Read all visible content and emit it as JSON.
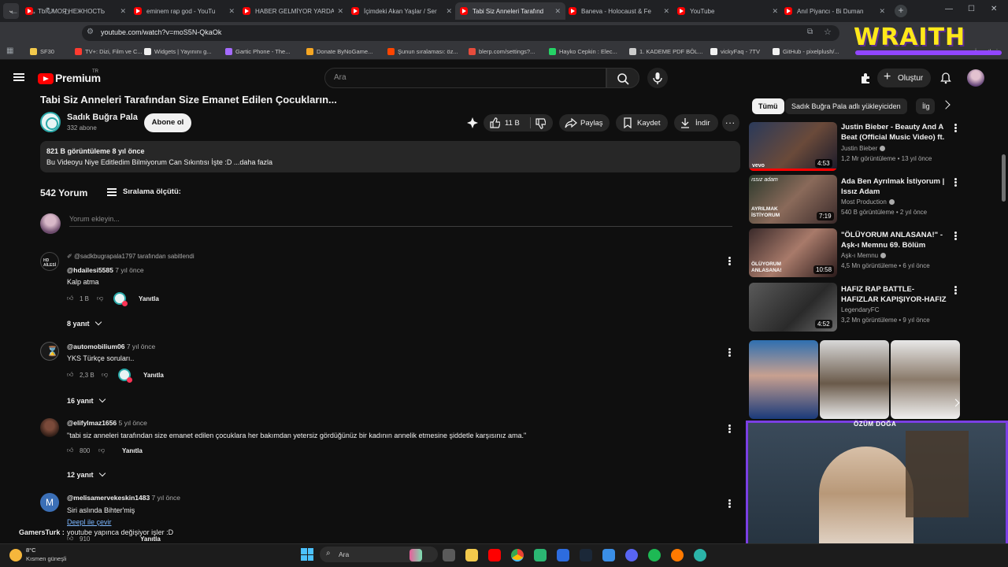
{
  "browser": {
    "tabs": [
      {
        "label": "Tbl - МОЯ НЕЖНОСТЬ",
        "active": false
      },
      {
        "label": "eminem rap god - YouTu",
        "active": false
      },
      {
        "label": "HABER GELMİYOR YARDA",
        "active": false
      },
      {
        "label": "İçimdeki Akan Yaşlar / Ser",
        "active": false
      },
      {
        "label": "Tabi Siz Anneleri Tarafınd",
        "active": true
      },
      {
        "label": "Baneva - Holocaust & Fe",
        "active": false
      },
      {
        "label": "YouTube",
        "active": false
      },
      {
        "label": "Anıl Piyancı - Bi Duman",
        "active": false
      }
    ],
    "url": "youtube.com/watch?v=moS5N-QkaOk",
    "bookmarks": [
      {
        "label": "SF30",
        "color": "#f2c94c"
      },
      {
        "label": "TV+: Dizi, Film ve C...",
        "color": "#ff3b30"
      },
      {
        "label": "Widgets | Yayınını g...",
        "color": "#eeeeee"
      },
      {
        "label": "Gartic Phone - The...",
        "color": "#a56bff"
      },
      {
        "label": "Donate ByNoGame...",
        "color": "#f5a623"
      },
      {
        "label": "Şunun sıralaması: öz...",
        "color": "#ff4500"
      },
      {
        "label": "blerp.com/settings?...",
        "color": "#e74c3c"
      },
      {
        "label": "Hayko Cepkin : Elec...",
        "color": "#25d366"
      },
      {
        "label": "1. KADEME PDF BÖL...",
        "color": "#cccccc"
      },
      {
        "label": "vickyFaq - 7TV",
        "color": "#f1f1f1"
      },
      {
        "label": "GitHub - pixelplush/...",
        "color": "#f1f1f1"
      }
    ],
    "bookmarks_more": "İşaretleri"
  },
  "overlay": {
    "brand": "WRAITH",
    "cam_name": "ÖZÜM DOĞA",
    "chat_user": "GamersTurk :",
    "chat_message": "youtube yapınca değişiyor işler :D",
    "translate_link": "Deepl ile çevir"
  },
  "header": {
    "brand": "Premium",
    "brand_sup": "TR",
    "search_placeholder": "Ara",
    "create_label": "Oluştur"
  },
  "video": {
    "title": "Tabi Siz Anneleri Tarafından Size Emanet Edilen Çocukların...",
    "channel": "Sadık Buğra Pala",
    "subscribers": "332 abone",
    "subscribe_label": "Abone ol",
    "likes": "11 B",
    "share_label": "Paylaş",
    "save_label": "Kaydet",
    "download_label": "İndir",
    "description_meta": "821 B görüntüleme  8 yıl önce",
    "description_text": "Bu Videoyu Niye Editledim Bilmiyorum Can Sıkıntısı İşte :D ...daha fazla"
  },
  "comments": {
    "count": "542 Yorum",
    "sort_label": "Sıralama ölçütü:",
    "add_placeholder": "Yorum ekleyin...",
    "reply_label": "Yanıtla",
    "items": [
      {
        "pinned": "@sadkbugrapala1797 tarafından sabitlendi",
        "handle": "@hdailesi5585",
        "age": "7 yıl önce",
        "text": "Kalp atma",
        "likes": "1 B",
        "replies": "8 yanıt"
      },
      {
        "pinned": "",
        "handle": "@automobilium06",
        "age": "7 yıl önce",
        "text": "YKS Türkçe soruları..",
        "likes": "2,3 B",
        "replies": "16 yanıt"
      },
      {
        "pinned": "",
        "handle": "@elifylmaz1656",
        "age": "5 yıl önce",
        "text": "\"tabi siz anneleri tarafından size emanet edilen çocuklara her bakımdan yetersiz gördüğünüz bir kadının annelik etmesine şiddetle karşısınız ama.\"",
        "likes": "800",
        "replies": "12 yanıt"
      },
      {
        "pinned": "",
        "handle": "@melisamervekeskin1483",
        "age": "7 yıl önce",
        "text": "Siri aslında Bihter'miş",
        "likes": "910",
        "replies": ""
      }
    ]
  },
  "sidebar": {
    "chips": [
      "Tümü",
      "Sadık Buğra Pala adlı yükleyiciden",
      "İlg"
    ],
    "videos": [
      {
        "title": "Justin Bieber - Beauty And A Beat (Official Music Video) ft. ...",
        "channel": "Justin Bieber",
        "meta": "1,2 Mr görüntüleme • 13 yıl önce",
        "duration": "4:53",
        "thumb_label": "vevo"
      },
      {
        "title": "Ada Ben Ayrılmak İstiyorum | Issız Adam",
        "channel": "Most Production",
        "meta": "540 B görüntüleme • 2 yıl önce",
        "duration": "7:19",
        "thumb_label": "AYRILMAK İSTİYORUM"
      },
      {
        "title": "\"ÖLÜYORUM ANLASANA!\" - Aşk-ı Memnu 69. Bölüm",
        "channel": "Aşk-ı Memnu",
        "meta": "4,5 Mn görüntüleme • 6 yıl önce",
        "duration": "10:58",
        "thumb_label": "ÖLÜYORUM ANLASANA!"
      },
      {
        "title": "HAFIZ RAP BATTLE-HAFIZLAR KAPIŞIYOR-HAFIZ LAF ...",
        "channel": "LegendaryFC",
        "meta": "3,2 Mn görüntüleme • 9 yıl önce",
        "duration": "4:52",
        "thumb_label": ""
      }
    ]
  },
  "taskbar": {
    "weather_temp": "8°C",
    "weather_desc": "Kısmen güneşli",
    "search_label": "Ara"
  }
}
